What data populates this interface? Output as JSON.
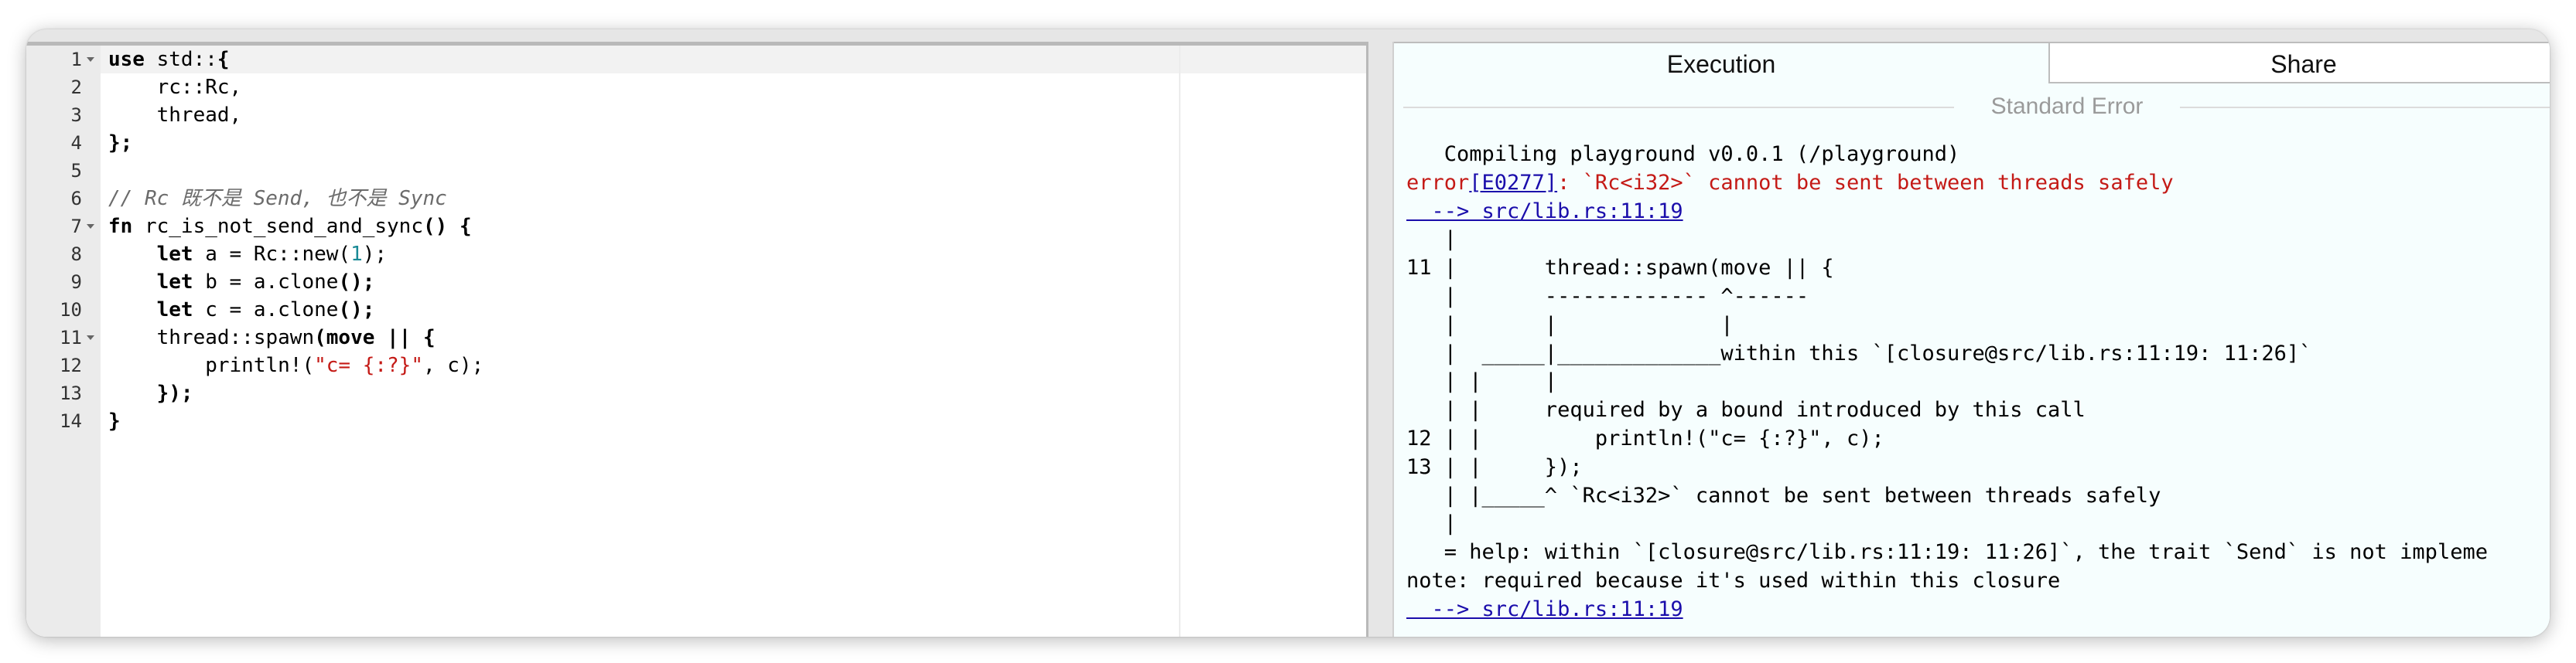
{
  "editor": {
    "lines": [
      {
        "num": "1",
        "fold": true,
        "parts": [
          {
            "t": "use",
            "c": "kw"
          },
          {
            "t": " std::",
            "c": ""
          },
          {
            "t": "{",
            "c": "bold"
          }
        ]
      },
      {
        "num": "2",
        "fold": false,
        "parts": [
          {
            "t": "    rc::Rc,",
            "c": ""
          }
        ]
      },
      {
        "num": "3",
        "fold": false,
        "parts": [
          {
            "t": "    thread,",
            "c": ""
          }
        ]
      },
      {
        "num": "4",
        "fold": false,
        "parts": [
          {
            "t": "};",
            "c": "bold"
          }
        ]
      },
      {
        "num": "5",
        "fold": false,
        "parts": []
      },
      {
        "num": "6",
        "fold": false,
        "parts": [
          {
            "t": "// Rc 既不是 Send, 也不是 Sync",
            "c": "cm"
          }
        ]
      },
      {
        "num": "7",
        "fold": true,
        "parts": [
          {
            "t": "fn",
            "c": "kw"
          },
          {
            "t": " rc_is_not_send_and_sync",
            "c": ""
          },
          {
            "t": "() {",
            "c": "bold"
          }
        ]
      },
      {
        "num": "8",
        "fold": false,
        "parts": [
          {
            "t": "    ",
            "c": ""
          },
          {
            "t": "let",
            "c": "kw"
          },
          {
            "t": " a = Rc::new(",
            "c": ""
          },
          {
            "t": "1",
            "c": "nu"
          },
          {
            "t": ");",
            "c": ""
          }
        ]
      },
      {
        "num": "9",
        "fold": false,
        "parts": [
          {
            "t": "    ",
            "c": ""
          },
          {
            "t": "let",
            "c": "kw"
          },
          {
            "t": " b = a.clone",
            "c": ""
          },
          {
            "t": "();",
            "c": "bold"
          }
        ]
      },
      {
        "num": "10",
        "fold": false,
        "parts": [
          {
            "t": "    ",
            "c": ""
          },
          {
            "t": "let",
            "c": "kw"
          },
          {
            "t": " c = a.clone",
            "c": ""
          },
          {
            "t": "();",
            "c": "bold"
          }
        ]
      },
      {
        "num": "11",
        "fold": true,
        "parts": [
          {
            "t": "    thread::spawn",
            "c": ""
          },
          {
            "t": "(move || {",
            "c": "kw"
          }
        ]
      },
      {
        "num": "12",
        "fold": false,
        "parts": [
          {
            "t": "        println!(",
            "c": ""
          },
          {
            "t": "\"c= {:?}\"",
            "c": "st"
          },
          {
            "t": ", c);",
            "c": ""
          }
        ]
      },
      {
        "num": "13",
        "fold": false,
        "parts": [
          {
            "t": "    });",
            "c": "bold"
          }
        ]
      },
      {
        "num": "14",
        "fold": false,
        "parts": [
          {
            "t": "}",
            "c": "bold"
          }
        ]
      }
    ]
  },
  "panel": {
    "tabs": {
      "execution": "Execution",
      "share": "Share"
    },
    "section_title": "Standard Error",
    "output": [
      [
        {
          "t": "   Compiling playground v0.0.1 (/playground)",
          "c": ""
        }
      ],
      [
        {
          "t": "error",
          "c": "err"
        },
        {
          "t": "[E0277]",
          "c": "link"
        },
        {
          "t": ": `Rc<i32>` cannot be sent between threads safely",
          "c": "err"
        }
      ],
      [
        {
          "t": "  --> src/lib.rs:11:19",
          "c": "link"
        }
      ],
      [
        {
          "t": "   |",
          "c": ""
        }
      ],
      [
        {
          "t": "11 |       thread::spawn(move || {",
          "c": ""
        }
      ],
      [
        {
          "t": "   |       ------------- ^------",
          "c": ""
        }
      ],
      [
        {
          "t": "   |       |             |",
          "c": ""
        }
      ],
      [
        {
          "t": "   |  _____|_____________within this `[closure@src/lib.rs:11:19: 11:26]`",
          "c": ""
        }
      ],
      [
        {
          "t": "   | |     |",
          "c": ""
        }
      ],
      [
        {
          "t": "   | |     required by a bound introduced by this call",
          "c": ""
        }
      ],
      [
        {
          "t": "12 | |         println!(\"c= {:?}\", c);",
          "c": ""
        }
      ],
      [
        {
          "t": "13 | |     });",
          "c": ""
        }
      ],
      [
        {
          "t": "   | |_____^ `Rc<i32>` cannot be sent between threads safely",
          "c": ""
        }
      ],
      [
        {
          "t": "   |",
          "c": ""
        }
      ],
      [
        {
          "t": "   = help: within `[closure@src/lib.rs:11:19: 11:26]`, the trait `Send` is not impleme",
          "c": ""
        }
      ],
      [
        {
          "t": "note: required because it's used within this closure",
          "c": ""
        }
      ],
      [
        {
          "t": "  --> src/lib.rs:11:19",
          "c": "link"
        }
      ]
    ]
  }
}
